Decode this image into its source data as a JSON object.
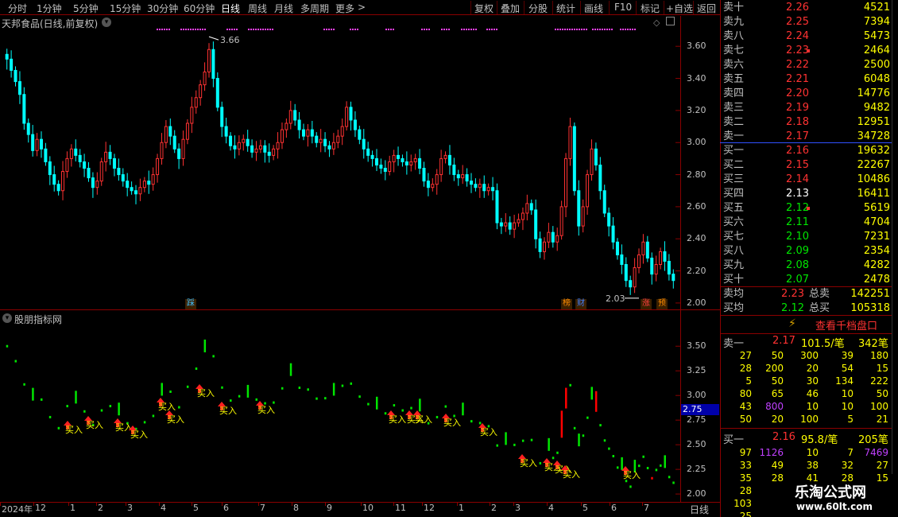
{
  "period_bar": {
    "items": [
      "分时",
      "1分钟",
      "5分钟",
      "15分钟",
      "30分钟",
      "60分钟",
      "日线",
      "周线",
      "月线",
      "多周期",
      "更多"
    ],
    "active": "日线",
    "more_arrow": ">"
  },
  "toolbar": {
    "buttons": [
      "复权",
      "叠加",
      "分股",
      "统计",
      "画线",
      "F10",
      "标记",
      "+自选",
      "返回"
    ]
  },
  "main_chart": {
    "title": "天邦食品(日线,前复权)",
    "y_ticks": [
      "3.60",
      "3.40",
      "3.20",
      "3.00",
      "2.80",
      "2.60",
      "2.40",
      "2.20",
      "2.00"
    ],
    "high_label": "3.66",
    "low_label": "2.03",
    "event_markers": [
      {
        "text": "踩",
        "color": "#40c0ff"
      },
      {
        "text": "榜",
        "color": "#ff8c00"
      },
      {
        "text": "财",
        "color": "#4080ff"
      },
      {
        "text": "涨",
        "color": "#ff4040"
      },
      {
        "text": "预",
        "color": "#ff8c00"
      }
    ]
  },
  "indicator": {
    "title": "股朋指标网",
    "y_ticks": [
      "3.50",
      "3.25",
      "3.00",
      "2.75",
      "2.50",
      "2.25",
      "2.00"
    ],
    "current_value": "2.75",
    "signal_label": "买入"
  },
  "x_axis": {
    "labels": [
      "2024年",
      "12",
      "1",
      "2",
      "3",
      "4",
      "5",
      "6",
      "7",
      "8",
      "9",
      "10",
      "11",
      "12",
      "1",
      "2",
      "3",
      "4",
      "5",
      "6",
      "7"
    ],
    "period": "日线"
  },
  "order_book": {
    "asks": [
      {
        "label": "卖十",
        "price": "2.26",
        "vol": "4521"
      },
      {
        "label": "卖九",
        "price": "2.25",
        "vol": "7394"
      },
      {
        "label": "卖八",
        "price": "2.24",
        "vol": "5473"
      },
      {
        "label": "卖七",
        "price": "2.23",
        "vol": "2464"
      },
      {
        "label": "卖六",
        "price": "2.22",
        "vol": "2500"
      },
      {
        "label": "卖五",
        "price": "2.21",
        "vol": "6048"
      },
      {
        "label": "卖四",
        "price": "2.20",
        "vol": "14776"
      },
      {
        "label": "卖三",
        "price": "2.19",
        "vol": "9482"
      },
      {
        "label": "卖二",
        "price": "2.18",
        "vol": "12951"
      },
      {
        "label": "卖一",
        "price": "2.17",
        "vol": "34728"
      }
    ],
    "bids": [
      {
        "label": "买一",
        "price": "2.16",
        "vol": "19632"
      },
      {
        "label": "买二",
        "price": "2.15",
        "vol": "22267"
      },
      {
        "label": "买三",
        "price": "2.14",
        "vol": "10486"
      },
      {
        "label": "买四",
        "price": "2.13",
        "vol": "16411"
      },
      {
        "label": "买五",
        "price": "2.12",
        "vol": "5619"
      },
      {
        "label": "买六",
        "price": "2.11",
        "vol": "4704"
      },
      {
        "label": "买七",
        "price": "2.10",
        "vol": "7231"
      },
      {
        "label": "买八",
        "price": "2.09",
        "vol": "2354"
      },
      {
        "label": "买九",
        "price": "2.08",
        "vol": "4282"
      },
      {
        "label": "买十",
        "price": "2.07",
        "vol": "2478"
      }
    ],
    "avg_sell": {
      "label": "卖均",
      "price": "2.23",
      "total_label": "总卖",
      "total": "142251"
    },
    "avg_buy": {
      "label": "买均",
      "price": "2.12",
      "total_label": "总买",
      "total": "105318"
    },
    "view_depth_label": "查看千档盘口"
  },
  "queue_sell": {
    "label": "卖一",
    "price": "2.17",
    "per_order": "101.5/笔",
    "count": "342笔",
    "rows": [
      [
        "27",
        "50",
        "300",
        "39",
        "180"
      ],
      [
        "28",
        "200",
        "20",
        "54",
        "15"
      ],
      [
        "5",
        "50",
        "30",
        "134",
        "222"
      ],
      [
        "80",
        "65",
        "46",
        "10",
        "50"
      ],
      [
        "43",
        "800",
        "10",
        "10",
        "100"
      ],
      [
        "50",
        "20",
        "100",
        "5",
        "21"
      ]
    ]
  },
  "queue_buy": {
    "label": "买一",
    "price": "2.16",
    "per_order": "95.8/笔",
    "count": "205笔",
    "rows": [
      [
        "97",
        "1126",
        "10",
        "7",
        "7469"
      ],
      [
        "33",
        "49",
        "38",
        "32",
        "27"
      ],
      [
        "35",
        "28",
        "41",
        "28",
        "15"
      ],
      [
        "28",
        "",
        "",
        " ",
        ""
      ],
      [
        "103",
        "",
        "",
        "",
        ""
      ],
      [
        "25",
        "",
        "",
        "",
        ""
      ]
    ]
  },
  "watermark": {
    "title": "乐淘公式网",
    "url": "www.60lt.com"
  },
  "colors": {
    "up": "#ff3232",
    "down": "#00ffff",
    "signal_green": "#00e600",
    "signal_red": "#ff0000",
    "border": "#8b0000"
  },
  "chart_data": {
    "type": "candlestick",
    "y_range": [
      1.96,
      3.72
    ],
    "close": [
      3.52,
      3.45,
      3.38,
      3.3,
      3.12,
      3.05,
      2.95,
      3.02,
      2.96,
      2.88,
      2.8,
      2.74,
      2.7,
      2.82,
      2.9,
      2.96,
      2.92,
      2.88,
      2.84,
      2.78,
      2.72,
      2.76,
      2.88,
      2.94,
      2.9,
      2.84,
      2.8,
      2.76,
      2.72,
      2.7,
      2.68,
      2.72,
      2.76,
      2.74,
      2.8,
      2.9,
      3.0,
      3.1,
      3.04,
      2.96,
      2.9,
      3.02,
      3.12,
      3.22,
      3.28,
      3.36,
      3.44,
      3.58,
      3.4,
      3.22,
      3.1,
      3.04,
      2.98,
      2.96,
      3.0,
      3.02,
      2.98,
      2.94,
      2.96,
      2.98,
      2.94,
      2.92,
      2.96,
      3.0,
      3.08,
      3.12,
      3.2,
      3.14,
      3.08,
      3.04,
      3.08,
      3.04,
      3.0,
      3.02,
      2.98,
      2.96,
      3.0,
      3.04,
      3.1,
      3.22,
      3.14,
      3.08,
      3.02,
      2.96,
      2.92,
      2.9,
      2.86,
      2.84,
      2.82,
      2.88,
      2.92,
      2.9,
      2.88,
      2.86,
      2.88,
      2.9,
      2.84,
      2.76,
      2.72,
      2.74,
      2.8,
      2.9,
      2.92,
      2.86,
      2.8,
      2.78,
      2.8,
      2.76,
      2.74,
      2.72,
      2.74,
      2.7,
      2.72,
      2.7,
      2.5,
      2.48,
      2.5,
      2.46,
      2.5,
      2.52,
      2.56,
      2.62,
      2.58,
      2.4,
      2.32,
      2.38,
      2.44,
      2.38,
      2.42,
      2.6,
      2.9,
      3.1,
      2.7,
      2.48,
      2.6,
      2.8,
      2.96,
      2.86,
      2.7,
      2.56,
      2.48,
      2.38,
      2.3,
      2.24,
      2.14,
      2.1,
      2.22,
      2.3,
      2.38,
      2.28,
      2.18,
      2.24,
      2.32,
      2.26,
      2.18,
      2.14
    ],
    "signals_buy_count": 20
  }
}
